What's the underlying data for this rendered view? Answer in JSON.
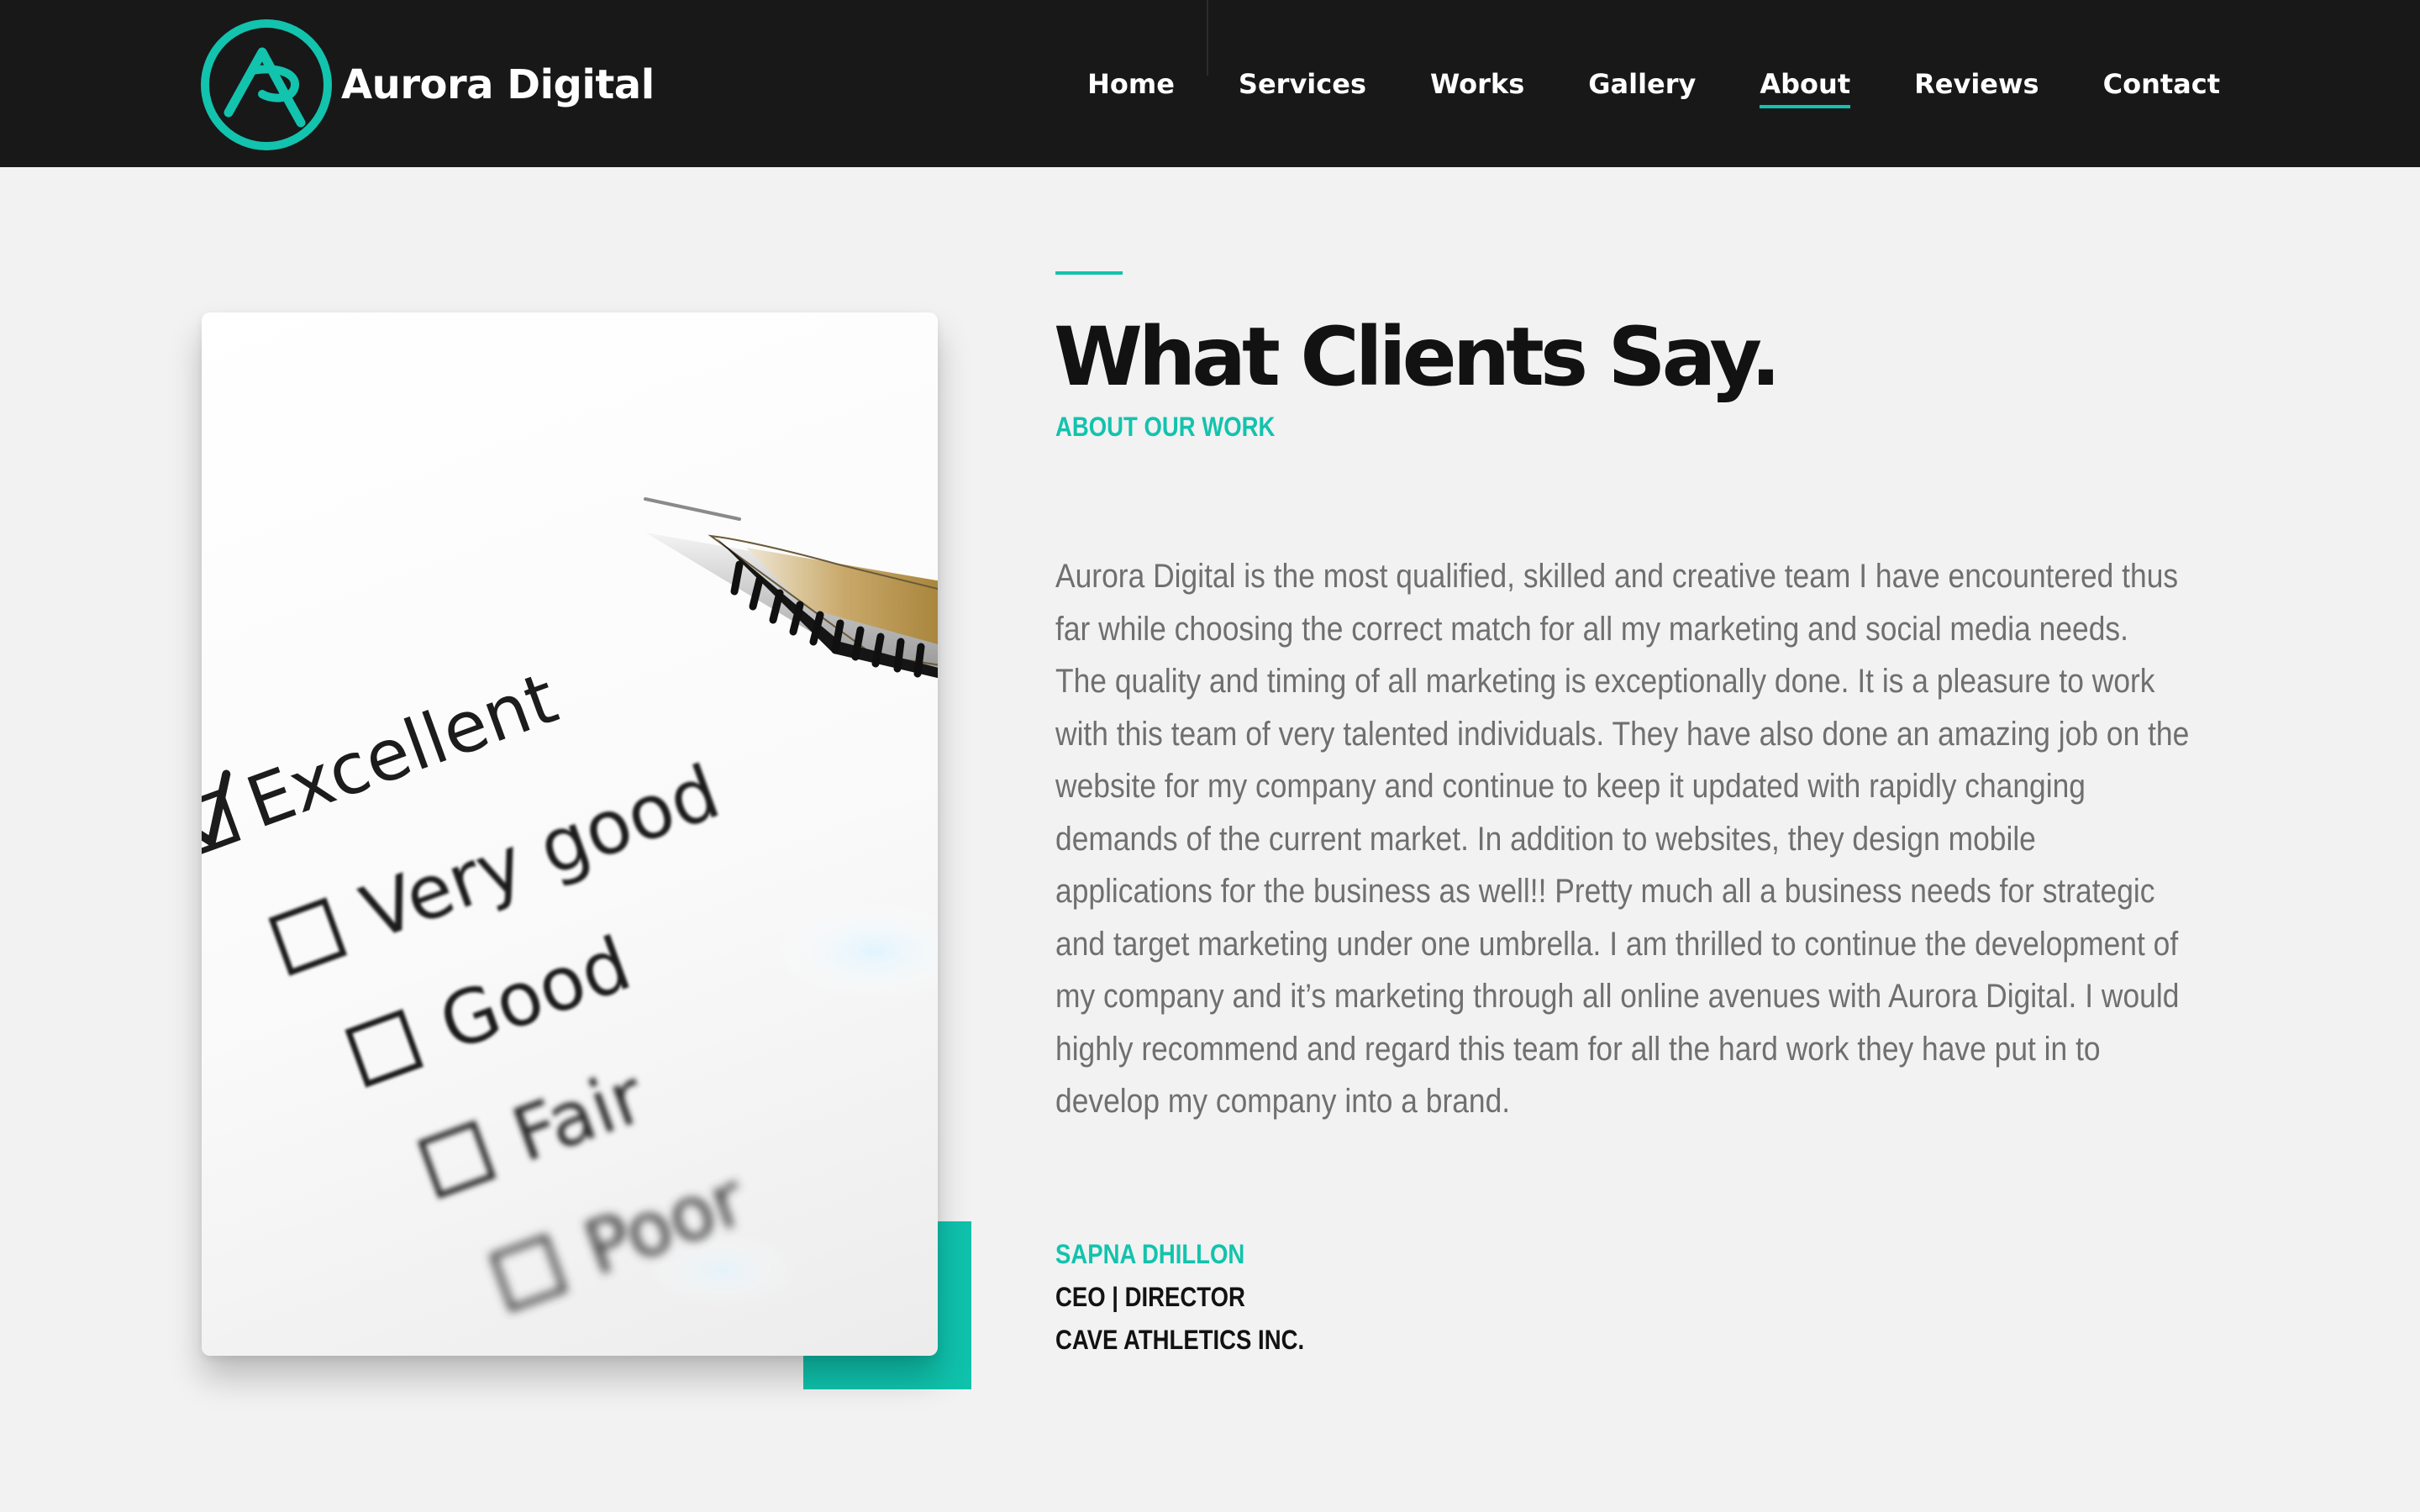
{
  "brand": {
    "name": "Aurora Digital",
    "accent_color": "#12c3ad",
    "header_bg": "#181818",
    "page_bg": "#f2f2f2"
  },
  "nav": {
    "items": [
      {
        "label": "Home",
        "active": false
      },
      {
        "label": "Services",
        "active": false
      },
      {
        "label": "Works",
        "active": false
      },
      {
        "label": "Gallery",
        "active": false
      },
      {
        "label": "About",
        "active": true
      },
      {
        "label": "Reviews",
        "active": false
      },
      {
        "label": "Contact",
        "active": false
      }
    ]
  },
  "image": {
    "icon": "rating-checklist-icon",
    "checklist": [
      {
        "label": "Excellent",
        "checked": true
      },
      {
        "label": "Very good",
        "checked": false
      },
      {
        "label": "Good",
        "checked": false
      },
      {
        "label": "Fair",
        "checked": false
      },
      {
        "label": "Poor",
        "checked": false
      }
    ]
  },
  "testimonial": {
    "heading": "What Clients Say.",
    "subheading": "ABOUT OUR WORK",
    "quote_lines": [
      "Aurora Digital is the most qualified, skilled and creative team I have encountered thus",
      "far while choosing the correct match for all my marketing and social media needs.",
      "The quality and timing of all marketing is exceptionally done. It is a pleasure to work",
      "with this team of very talented individuals. They have also done an amazing job on the",
      "website for my company and continue to keep it updated with rapidly changing",
      "demands of the current market. In addition to websites, they design mobile",
      "applications for the business as well!! Pretty much all a business needs for strategic",
      "and target marketing under one umbrella. I am thrilled to continue the development of",
      "my company and it’s marketing through all online avenues with Aurora Digital. I would",
      "highly recommend and regard this team for all the hard work they have put in to",
      "develop my company into a brand."
    ],
    "author": {
      "name": "SAPNA DHILLON",
      "role": "CEO | DIRECTOR",
      "company": "CAVE ATHLETICS INC."
    }
  }
}
